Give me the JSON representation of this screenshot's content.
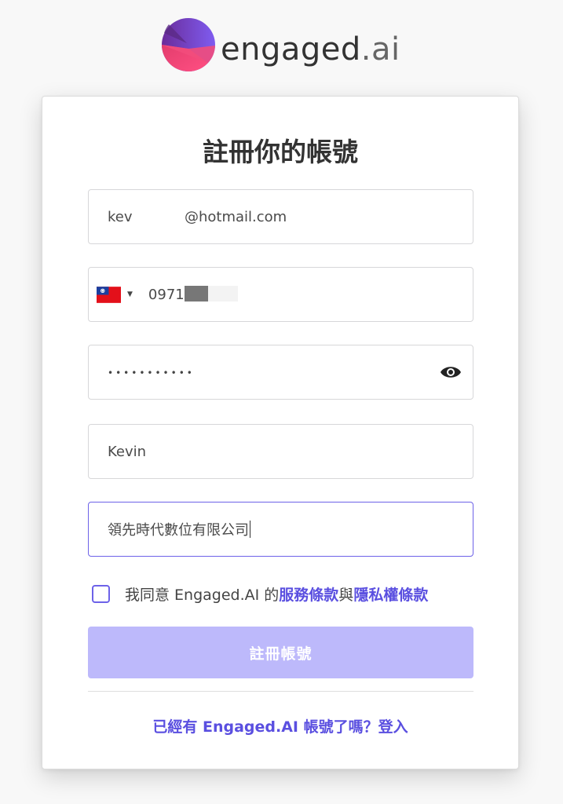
{
  "brand": {
    "name": "engaged",
    "suffix": ".ai",
    "colors": {
      "primary": "#6d62e8",
      "pink": "#f0437c",
      "purple": "#7a3fc4"
    }
  },
  "form": {
    "title": "註冊你的帳號",
    "email": {
      "local": "kev",
      "domain": "@hotmail.com"
    },
    "phone": {
      "country_flag": "taiwan-flag-icon",
      "number_visible": "0971"
    },
    "password": {
      "masked_value": "•••••••••••"
    },
    "name": {
      "value": "Kevin"
    },
    "company": {
      "value": "領先時代數位有限公司"
    },
    "agreement": {
      "prefix": "我同意 Engaged.AI 的",
      "terms_label": "服務條款",
      "conjunction": "與",
      "privacy_label": "隱私權條款"
    },
    "submit_label": "註冊帳號",
    "login_prompt": "已經有 Engaged.AI 帳號了嗎？登入"
  }
}
